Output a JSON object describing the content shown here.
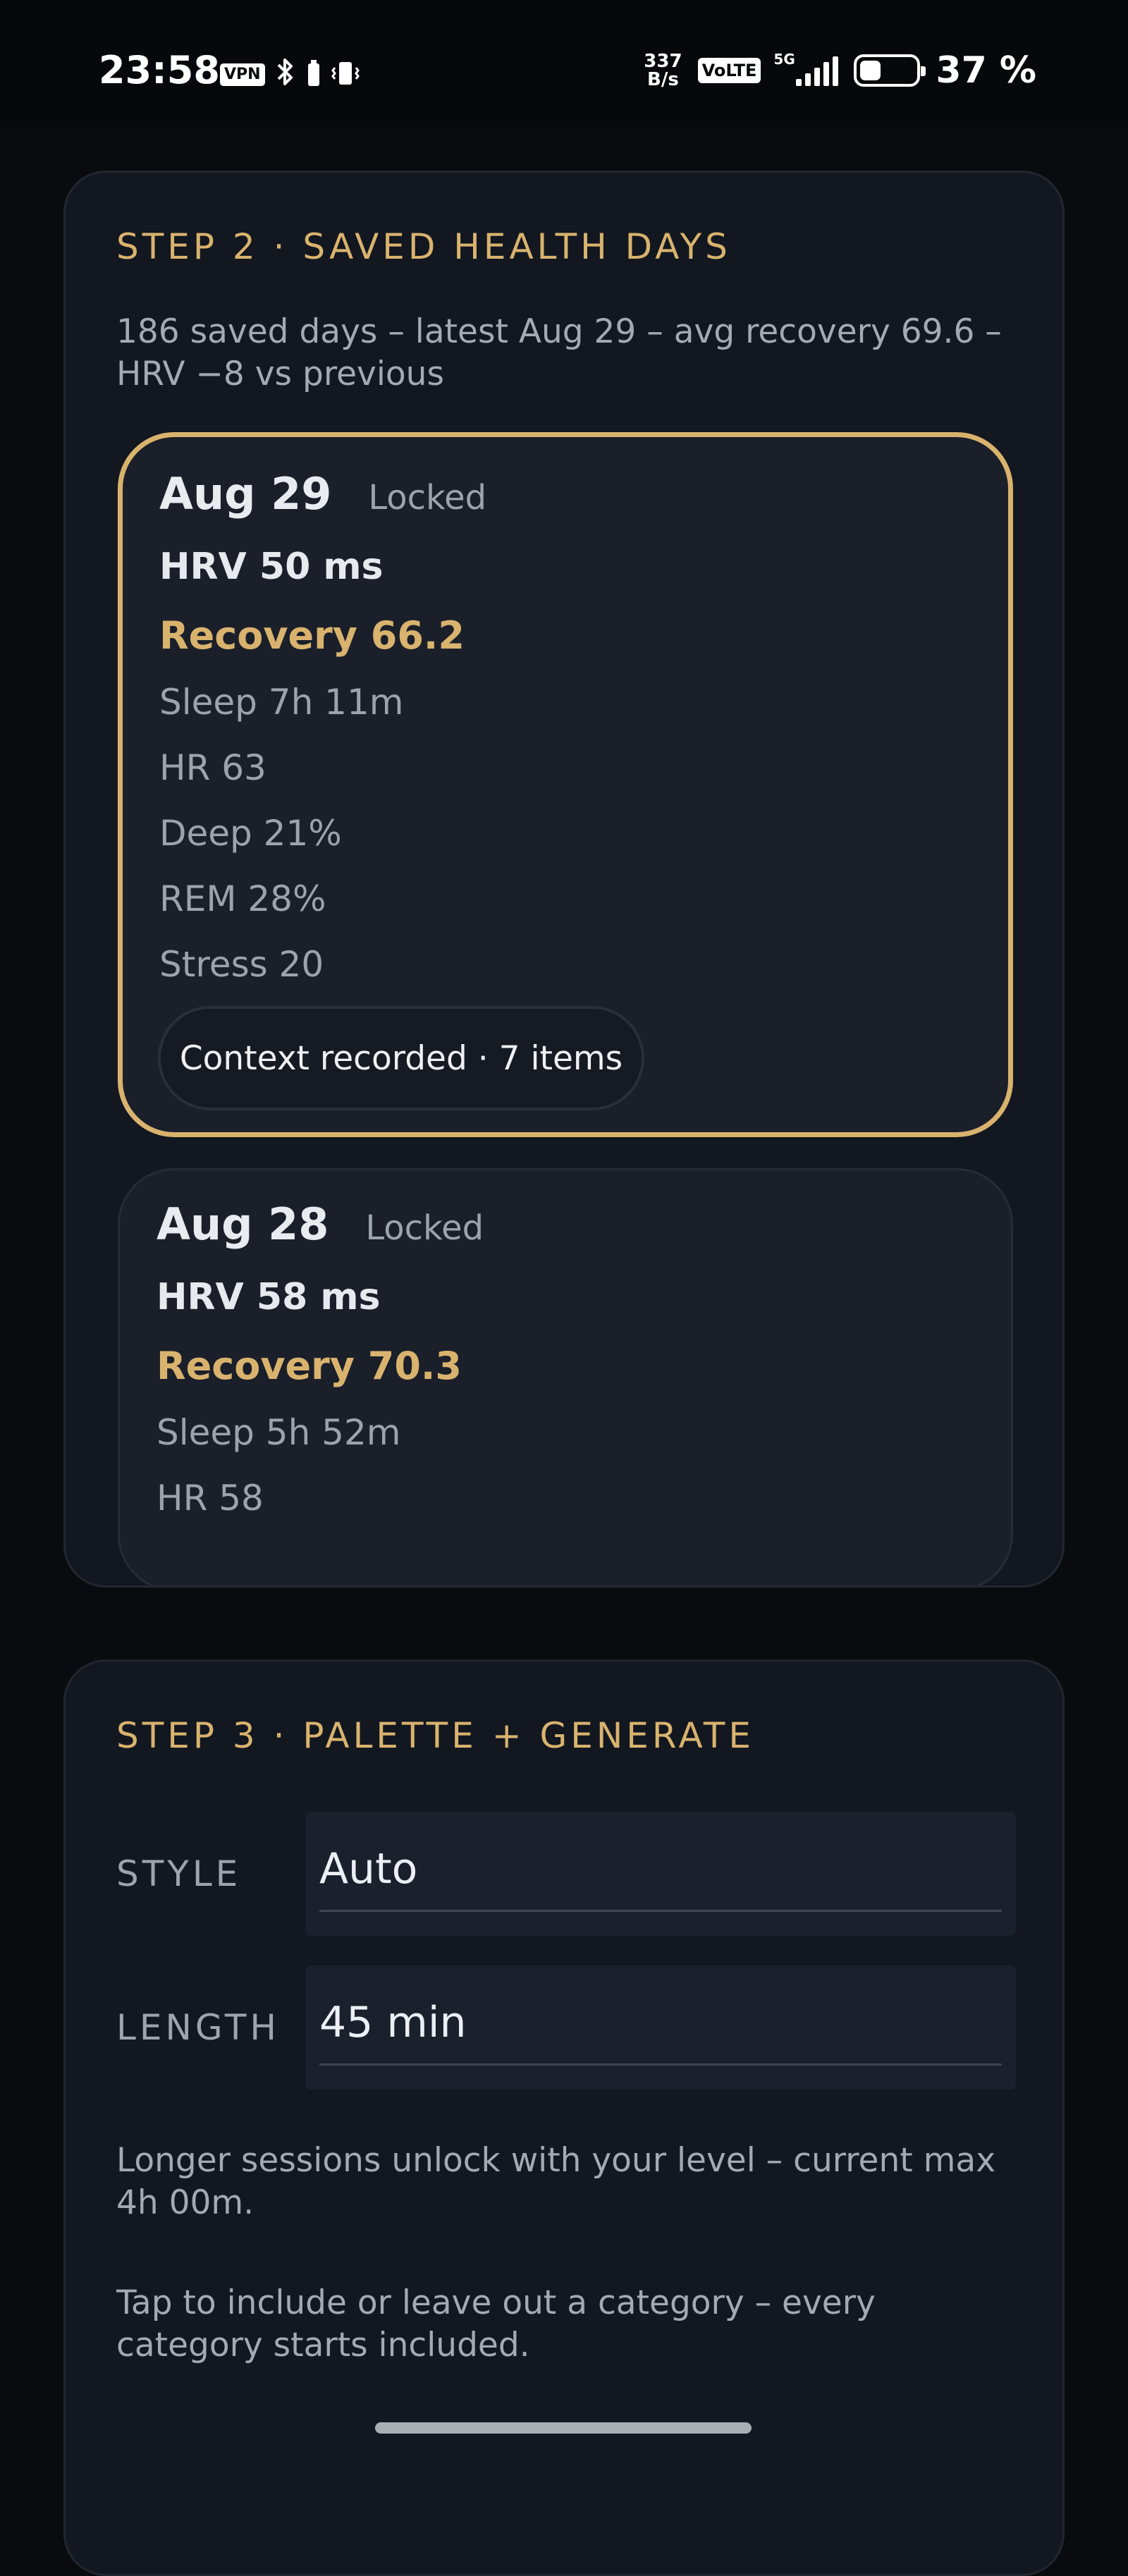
{
  "status_bar": {
    "time": "23:58",
    "vpn": "VPN",
    "net_speed_value": "337",
    "net_speed_unit": "B/s",
    "volte": "VoLTE",
    "network": "5G",
    "battery": "37 %",
    "battery_level": 0.37
  },
  "step2": {
    "title": "STEP 2 · SAVED HEALTH DAYS",
    "summary": "186 saved days – latest Aug 29 – avg recovery 69.6 – HRV −8 vs previous",
    "days": [
      {
        "date": "Aug 29",
        "state": "Locked",
        "hrv": "HRV 50 ms",
        "recovery": "Recovery 66.2",
        "sleep": "Sleep 7h 11m",
        "hr": "HR 63",
        "deep": "Deep 21%",
        "rem": "REM 28%",
        "stress": "Stress 20",
        "context": "Context recorded · 7 items"
      },
      {
        "date": "Aug 28",
        "state": "Locked",
        "hrv": "HRV 58 ms",
        "recovery": "Recovery 70.3",
        "sleep": "Sleep 5h 52m",
        "hr": "HR 58"
      }
    ]
  },
  "step3": {
    "title": "STEP 3 · PALETTE + GENERATE",
    "style_label": "STYLE",
    "style_value": "Auto",
    "length_label": "LENGTH",
    "length_value": "45 min",
    "length_help": "Longer sessions unlock with your level – current max 4h 00m.",
    "category_help": "Tap to include or leave out a category – every category starts included."
  },
  "colors": {
    "accent": "#d9b36e",
    "background": "#090b0f",
    "card": "#121720"
  }
}
